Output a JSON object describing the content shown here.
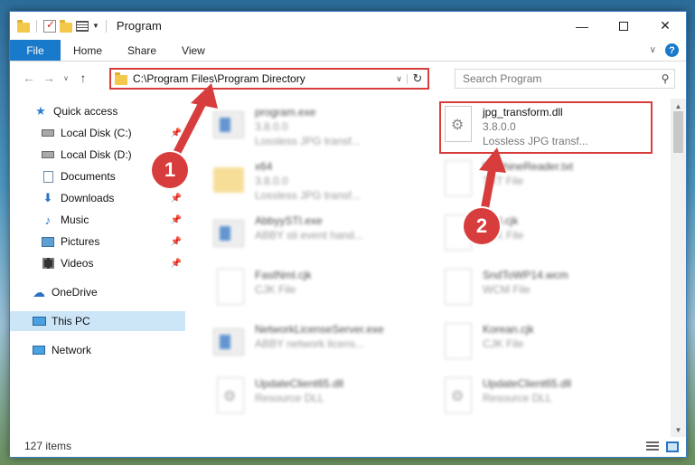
{
  "window": {
    "title": "Program"
  },
  "ribbon": {
    "tabs": [
      "File",
      "Home",
      "Share",
      "View"
    ],
    "help": "?"
  },
  "address": {
    "path": "C:\\Program Files\\Program Directory"
  },
  "search": {
    "placeholder": "Search Program"
  },
  "nav": {
    "items": [
      {
        "label": "Quick access"
      },
      {
        "label": "Local Disk (C:)"
      },
      {
        "label": "Local Disk (D:)"
      },
      {
        "label": "Documents"
      },
      {
        "label": "Downloads"
      },
      {
        "label": "Music"
      },
      {
        "label": "Pictures"
      },
      {
        "label": "Videos"
      },
      {
        "label": "OneDrive"
      },
      {
        "label": "This PC"
      },
      {
        "label": "Network"
      }
    ]
  },
  "files": {
    "left": [
      {
        "name": "program.exe",
        "meta1": "3.8.0.0",
        "meta2": "Lossless JPG transf..."
      },
      {
        "name": "x64",
        "meta1": "3.8.0.0",
        "meta2": "Lossless JPG transf..."
      },
      {
        "name": "AbbyySTI.exe",
        "meta1": "ABBY sti event hand..."
      },
      {
        "name": "FastNml.cjk",
        "meta1": "CJK File"
      },
      {
        "name": "NetworkLicenseServer.exe",
        "meta1": "ABBY network licens..."
      },
      {
        "name": "UpdateClient65.dll",
        "meta1": "Resource DLL"
      }
    ],
    "right": [
      {
        "name": "jpg_transform.dll",
        "meta1": "3.8.0.0",
        "meta2": "Lossless JPG transf..."
      },
      {
        "name": "MachineReader.txt",
        "meta1": "TXT File"
      },
      {
        "name": "Nml.cjk",
        "meta1": "CJK File"
      },
      {
        "name": "SndToWP14.wcm",
        "meta1": "WCM File"
      },
      {
        "name": "Korean.cjk",
        "meta1": "CJK File"
      },
      {
        "name": "UpdateClient65.dll",
        "meta1": "Resource DLL"
      }
    ]
  },
  "status": {
    "count": "127 items"
  },
  "annotations": {
    "step1": "1",
    "step2": "2",
    "color": "#d83d3d"
  }
}
